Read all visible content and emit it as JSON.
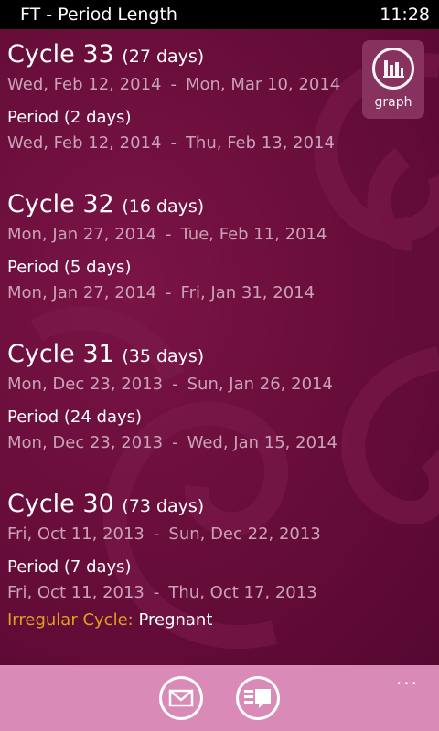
{
  "status": {
    "app_title": "FT - Period Length",
    "time": "11:28"
  },
  "graph_button": {
    "label": "graph",
    "icon": "bar-chart-icon"
  },
  "cycles": [
    {
      "title": "Cycle 33",
      "days": "(27 days)",
      "start": "Wed, Feb 12, 2014",
      "end": "Mon, Mar 10, 2014",
      "period_title": "Period",
      "period_days": "(2 days)",
      "period_start": "Wed, Feb 12, 2014",
      "period_end": "Thu, Feb 13, 2014"
    },
    {
      "title": "Cycle 32",
      "days": "(16 days)",
      "start": "Mon, Jan 27, 2014",
      "end": "Tue, Feb 11, 2014",
      "period_title": "Period",
      "period_days": "(5 days)",
      "period_start": "Mon, Jan 27, 2014",
      "period_end": "Fri, Jan 31, 2014"
    },
    {
      "title": "Cycle 31",
      "days": "(35 days)",
      "start": "Mon, Dec 23, 2013",
      "end": "Sun, Jan 26, 2014",
      "period_title": "Period",
      "period_days": "(24 days)",
      "period_start": "Mon, Dec 23, 2013",
      "period_end": "Wed, Jan 15, 2014"
    },
    {
      "title": "Cycle 30",
      "days": "(73 days)",
      "start": "Fri, Oct 11, 2013",
      "end": "Sun, Dec 22, 2013",
      "period_title": "Period",
      "period_days": "(7 days)",
      "period_start": "Fri, Oct 11, 2013",
      "period_end": "Thu, Oct 17, 2013",
      "irregular_label": "Irregular Cycle:",
      "irregular_value": "Pregnant"
    }
  ],
  "separator": "-",
  "appbar": {
    "buttons": [
      {
        "name": "email-button",
        "icon": "envelope-icon"
      },
      {
        "name": "feedback-button",
        "icon": "list-comment-icon"
      }
    ],
    "more": "..."
  },
  "colors": {
    "background": "#6b0e3c",
    "appbar": "#d98ab7",
    "secondary_text": "#c9a3b5",
    "irregular_label": "#e0a020"
  }
}
